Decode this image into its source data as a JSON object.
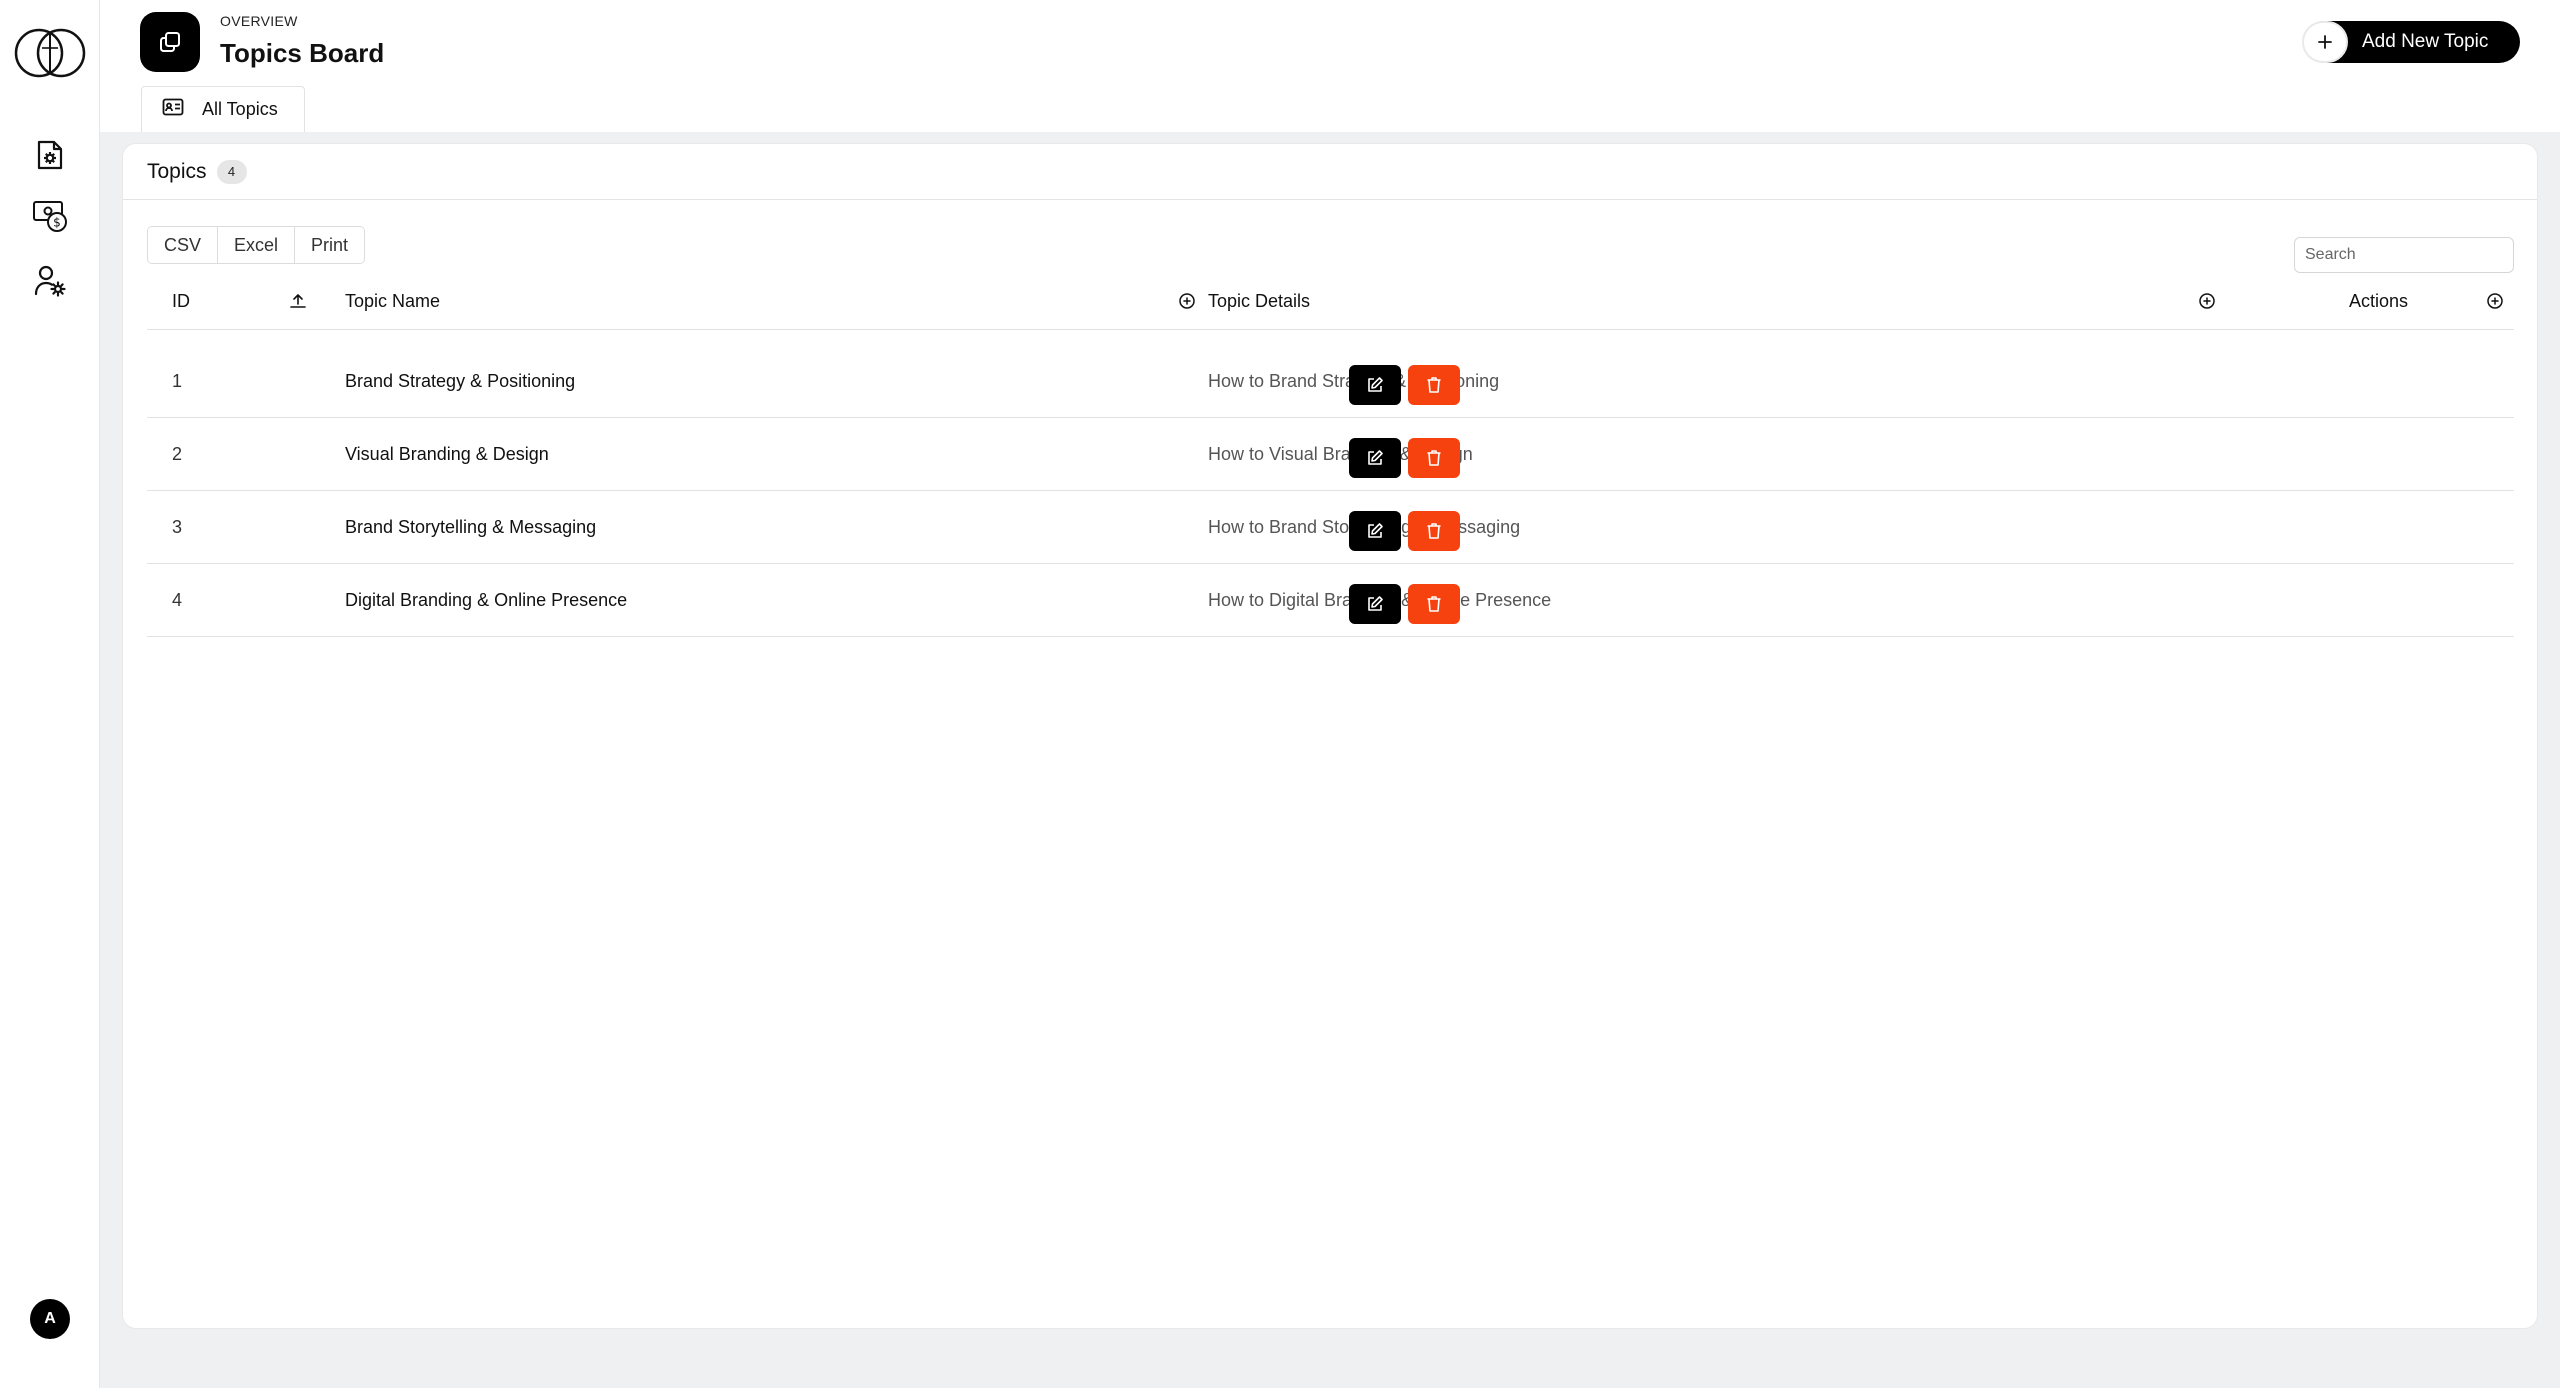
{
  "header": {
    "overline": "OVERVIEW",
    "title": "Topics Board",
    "add_button_label": "Add New Topic",
    "tabs": [
      {
        "label": "All Topics",
        "active": true
      }
    ]
  },
  "sidebar": {
    "items": [
      {
        "icon": "document-settings-icon"
      },
      {
        "icon": "money-refresh-icon"
      },
      {
        "icon": "user-settings-icon"
      }
    ],
    "avatar_initial": "A"
  },
  "card": {
    "title": "Topics",
    "count": "4",
    "export_buttons": [
      "CSV",
      "Excel",
      "Print"
    ],
    "search_placeholder": "Search"
  },
  "table": {
    "columns": [
      "ID",
      "Topic Name",
      "Topic Details",
      "Actions"
    ],
    "rows": [
      {
        "id": "1",
        "name": "Brand Strategy & Positioning",
        "details": "How to Brand Strategy & Positioning"
      },
      {
        "id": "2",
        "name": "Visual Branding & Design",
        "details": "How to Visual Branding & Design"
      },
      {
        "id": "3",
        "name": "Brand Storytelling & Messaging",
        "details": "How to Brand Storytelling & Messaging"
      },
      {
        "id": "4",
        "name": "Digital Branding & Online Presence",
        "details": "How to Digital Branding & Online Presence"
      }
    ]
  },
  "colors": {
    "accent": "#000000",
    "danger": "#f5420f",
    "background": "#eef0f2"
  }
}
